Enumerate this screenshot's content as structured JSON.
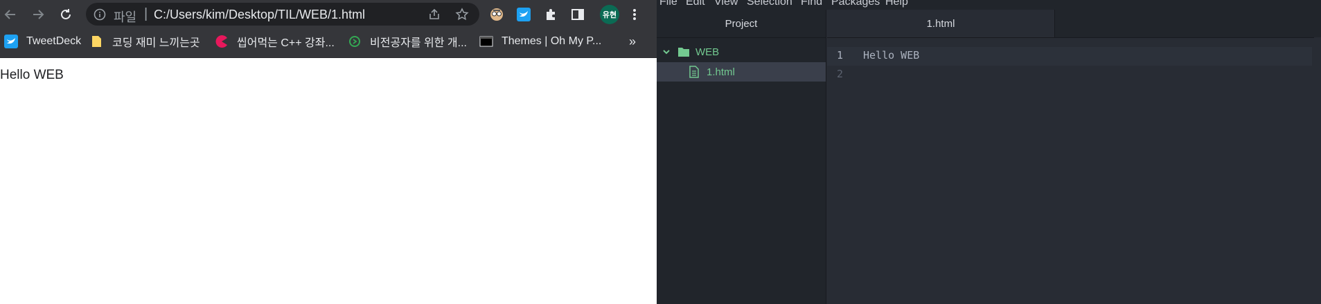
{
  "browser": {
    "omnibox": {
      "scheme_label": "파일",
      "url": "C:/Users/kim/Desktop/TIL/WEB/1.html"
    },
    "profile_initials": "유현",
    "bookmarks": [
      {
        "label": "TweetDeck",
        "icon": "twitter-icon"
      },
      {
        "label": "코딩 재미 느끼는곳",
        "icon": "folder-icon"
      },
      {
        "label": "씹어먹는 C++ 강좌...",
        "icon": "pacman-icon"
      },
      {
        "label": "비전공자를 위한 개...",
        "icon": "green-circle-icon"
      },
      {
        "label": "Themes | Oh My P...",
        "icon": "terminal-icon"
      }
    ],
    "more_bookmarks": "»",
    "page_content": "Hello WEB"
  },
  "atom": {
    "menu": [
      "File",
      "Edit",
      "View",
      "Selection",
      "Find",
      "Packages",
      "Help"
    ],
    "tree_header": "Project",
    "tree": {
      "folder": "WEB",
      "file": "1.html"
    },
    "active_tab": "1.html",
    "line_numbers": [
      "1",
      "2"
    ],
    "code_lines": [
      "Hello WEB",
      ""
    ],
    "colors": {
      "accent_green": "#73c990",
      "bg": "#282c34",
      "panel": "#21252b"
    }
  }
}
